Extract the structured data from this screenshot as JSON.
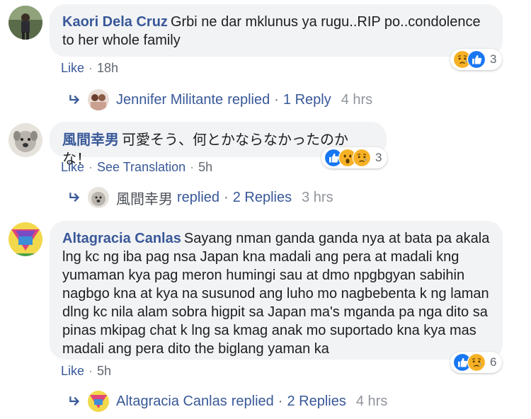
{
  "comments": [
    {
      "author": "Kaori Dela Cruz",
      "text": "Grbi ne dar mklunus ya rugu..RIP po..condolence to her whole family",
      "like_label": "Like",
      "time": "18h",
      "reaction_count": "3",
      "reactions": [
        "sad-icon",
        "like-icon"
      ],
      "reply": {
        "name": "Jennifer Militante",
        "replied_label": "replied",
        "count_label": "1 Reply",
        "time": "4 hrs"
      }
    },
    {
      "author": "風間幸男",
      "text": "可愛そう、何とかならなかったのかな！",
      "like_label": "Like",
      "translate_label": "See Translation",
      "time": "5h",
      "reaction_count": "3",
      "reactions": [
        "like-icon",
        "wow-icon",
        "sad-icon"
      ],
      "reply": {
        "name": "風間幸男",
        "replied_label": "replied",
        "count_label": "2 Replies",
        "time": "3 hrs"
      }
    },
    {
      "author": "Altagracia Canlas",
      "text": "Sayang nman ganda ganda nya at bata pa akala lng kc ng iba pag nsa Japan kna madali ang pera at madali kng yumaman kya pag meron humingi sau at dmo npgbgyan sabihin nagbgo kna at kya na susunod ang luho mo nagbebenta k ng laman dlng kc nila alam sobra higpit sa Japan ma's mganda pa nga dito sa pinas mkipag chat k lng sa kmag anak mo suportado kna kya mas madali ang pera dito the biglang yaman ka",
      "like_label": "Like",
      "time": "5h",
      "reaction_count": "6",
      "reactions": [
        "like-icon",
        "sad-icon"
      ],
      "reply": {
        "name": "Altagracia Canlas",
        "replied_label": "replied",
        "count_label": "2 Replies",
        "time": "4 hrs"
      }
    }
  ],
  "colors": {
    "link": "#385898",
    "bubble": "#f2f3f5",
    "like": "#1877f2",
    "emoji": "#f7b125"
  }
}
